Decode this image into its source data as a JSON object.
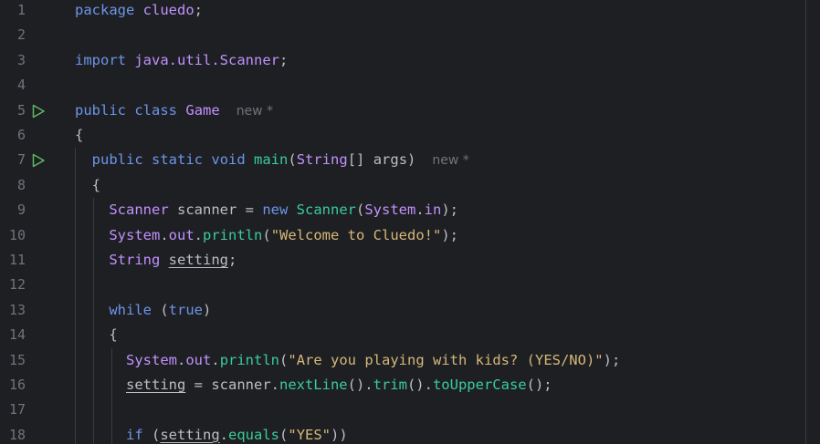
{
  "editor": {
    "lines": [
      {
        "n": "1",
        "tokens": [
          [
            "kw2",
            "package"
          ],
          [
            "var",
            " "
          ],
          [
            "cls",
            "cluedo"
          ],
          [
            "var",
            ";"
          ]
        ]
      },
      {
        "n": "2",
        "tokens": []
      },
      {
        "n": "3",
        "tokens": [
          [
            "kw2",
            "import"
          ],
          [
            "var",
            " "
          ],
          [
            "cls",
            "java.util.Scanner"
          ],
          [
            "var",
            ";"
          ]
        ]
      },
      {
        "n": "4",
        "tokens": []
      },
      {
        "n": "5",
        "run": true,
        "tokens": [
          [
            "kw2",
            "public"
          ],
          [
            "var",
            " "
          ],
          [
            "kw2",
            "class"
          ],
          [
            "var",
            " "
          ],
          [
            "cls",
            "Game"
          ]
        ],
        "hint": "new *"
      },
      {
        "n": "6",
        "tokens": [
          [
            "var",
            "{"
          ]
        ]
      },
      {
        "n": "7",
        "run": true,
        "tokens": [
          [
            "var",
            "  "
          ],
          [
            "kw2",
            "public"
          ],
          [
            "var",
            " "
          ],
          [
            "kw2",
            "static"
          ],
          [
            "var",
            " "
          ],
          [
            "kw2",
            "void"
          ],
          [
            "var",
            " "
          ],
          [
            "fn",
            "main"
          ],
          [
            "var",
            "("
          ],
          [
            "cls",
            "String"
          ],
          [
            "var",
            "[] args)"
          ]
        ],
        "hint": "new *"
      },
      {
        "n": "8",
        "tokens": [
          [
            "var",
            "  {"
          ]
        ]
      },
      {
        "n": "9",
        "tokens": [
          [
            "var",
            "    "
          ],
          [
            "cls",
            "Scanner"
          ],
          [
            "var",
            " scanner = "
          ],
          [
            "kw2",
            "new"
          ],
          [
            "var",
            " "
          ],
          [
            "fn",
            "Scanner"
          ],
          [
            "var",
            "("
          ],
          [
            "cls",
            "System"
          ],
          [
            "var",
            "."
          ],
          [
            "fld",
            "in"
          ],
          [
            "var",
            ");"
          ]
        ]
      },
      {
        "n": "10",
        "tokens": [
          [
            "var",
            "    "
          ],
          [
            "cls",
            "System"
          ],
          [
            "var",
            "."
          ],
          [
            "fld",
            "out"
          ],
          [
            "var",
            "."
          ],
          [
            "fn",
            "println"
          ],
          [
            "var",
            "("
          ],
          [
            "str",
            "\"Welcome to Cluedo!\""
          ],
          [
            "var",
            ");"
          ]
        ]
      },
      {
        "n": "11",
        "tokens": [
          [
            "var",
            "    "
          ],
          [
            "cls",
            "String"
          ],
          [
            "var",
            " "
          ],
          [
            "uvar",
            "setting"
          ],
          [
            "var",
            ";"
          ]
        ]
      },
      {
        "n": "12",
        "tokens": []
      },
      {
        "n": "13",
        "tokens": [
          [
            "var",
            "    "
          ],
          [
            "kw2",
            "while"
          ],
          [
            "var",
            " ("
          ],
          [
            "kw2",
            "true"
          ],
          [
            "var",
            ")"
          ]
        ]
      },
      {
        "n": "14",
        "tokens": [
          [
            "var",
            "    {"
          ]
        ]
      },
      {
        "n": "15",
        "tokens": [
          [
            "var",
            "      "
          ],
          [
            "cls",
            "System"
          ],
          [
            "var",
            "."
          ],
          [
            "fld",
            "out"
          ],
          [
            "var",
            "."
          ],
          [
            "fn",
            "println"
          ],
          [
            "var",
            "("
          ],
          [
            "str",
            "\"Are you playing with kids? (YES/NO)\""
          ],
          [
            "var",
            ");"
          ]
        ]
      },
      {
        "n": "16",
        "tokens": [
          [
            "var",
            "      "
          ],
          [
            "uvar",
            "setting"
          ],
          [
            "var",
            " = scanner."
          ],
          [
            "fn",
            "nextLine"
          ],
          [
            "var",
            "()."
          ],
          [
            "fn",
            "trim"
          ],
          [
            "var",
            "()."
          ],
          [
            "fn",
            "toUpperCase"
          ],
          [
            "var",
            "();"
          ]
        ]
      },
      {
        "n": "17",
        "tokens": []
      },
      {
        "n": "18",
        "tokens": [
          [
            "var",
            "      "
          ],
          [
            "kw2",
            "if"
          ],
          [
            "var",
            " ("
          ],
          [
            "uvar",
            "setting"
          ],
          [
            "var",
            "."
          ],
          [
            "fn",
            "equals"
          ],
          [
            "var",
            "("
          ],
          [
            "str",
            "\"YES\""
          ],
          [
            "var",
            "))"
          ]
        ]
      }
    ],
    "colors": {
      "background": "#1e1f22",
      "keyword": "#6c95eb",
      "class": "#c191ff",
      "method": "#39cc9b",
      "string": "#d5b778",
      "text": "#bcbec4",
      "line_number": "#6f737a",
      "run_icon": "#5fb865"
    },
    "icons": {
      "run": "run-gutter-icon"
    }
  }
}
